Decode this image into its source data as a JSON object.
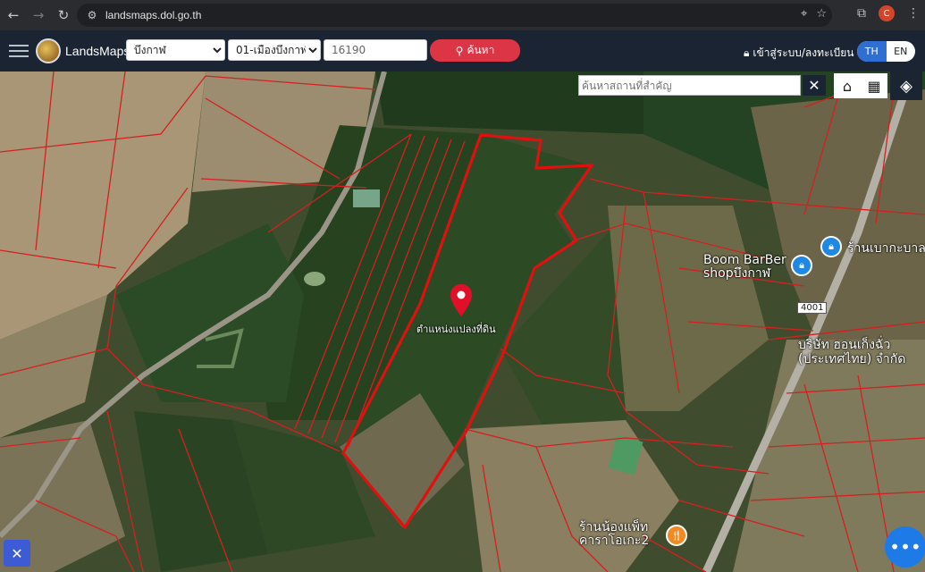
{
  "browser": {
    "url": "landsmaps.dol.go.th",
    "profile_initial": "C"
  },
  "header": {
    "brand": "LandsMaps",
    "province_select": "บึงกาฬ",
    "district_select": "01-เมืองบึงกาฬ",
    "parcel_code": "16190",
    "search_label": "ค้นหา",
    "login_label": "เข้าสู่ระบบ/ลงทะเบียน",
    "lang_th": "TH",
    "lang_en": "EN"
  },
  "map": {
    "place_search_placeholder": "ค้นหาสถานที่สำคัญ",
    "parcel_label": "ตำแหน่งแปลงที่ดิน",
    "poi_barber": "Boom BarBer shopบึงกาฬ",
    "poi_shop_right": "ร้านเบากะบาล",
    "poi_company": "บริษัท ฮอนเก็งฉั่ว (ประเทศไทย) จำกัด",
    "poi_karaoke": "ร้านน้องแพ็ท คาราโอเกะ2",
    "road_number": "4001"
  },
  "icons": {
    "back": "back-arrow-icon",
    "forward": "forward-arrow-icon",
    "reload": "reload-icon",
    "site_info": "tune-icon",
    "location": "location-icon",
    "star": "star-icon",
    "extensions": "puzzle-icon",
    "menu": "more-vert-icon",
    "home": "home-icon",
    "grid": "grid-icon",
    "layers": "layers-icon",
    "pin": "map-pin-icon"
  },
  "colors": {
    "header_bg": "#1a2432",
    "search_btn": "#dc3545",
    "lang_active": "#2f6fd4",
    "parcel_outline": "#e01010",
    "boundary_lines": "#d42020"
  }
}
